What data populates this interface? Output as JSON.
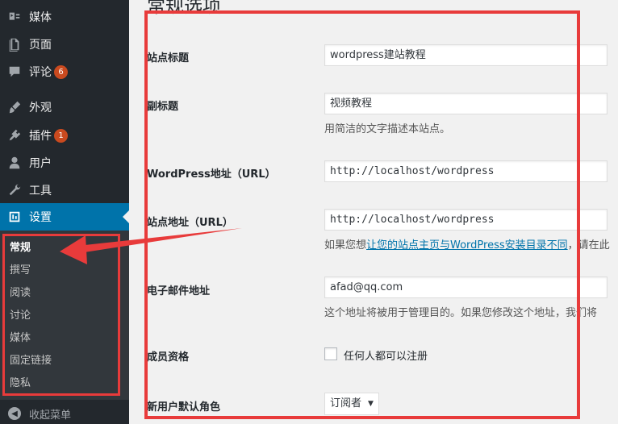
{
  "sidebar": {
    "items": [
      {
        "label": "媒体",
        "icon": "media-icon"
      },
      {
        "label": "页面",
        "icon": "page-icon"
      },
      {
        "label": "评论",
        "icon": "comment-icon",
        "badge": "6"
      },
      {
        "label": "外观",
        "icon": "appearance-icon"
      },
      {
        "label": "插件",
        "icon": "plugin-icon",
        "badge": "1"
      },
      {
        "label": "用户",
        "icon": "user-icon"
      },
      {
        "label": "工具",
        "icon": "tools-icon"
      },
      {
        "label": "设置",
        "icon": "settings-icon"
      }
    ],
    "submenu": [
      "常规",
      "撰写",
      "阅读",
      "讨论",
      "媒体",
      "固定链接",
      "隐私"
    ],
    "collapse_label": "收起菜单"
  },
  "main": {
    "title": "常规选项",
    "fields": {
      "site_title": {
        "label": "站点标题",
        "value": "wordpress建站教程"
      },
      "tagline": {
        "label": "副标题",
        "value": "视频教程",
        "desc": "用简洁的文字描述本站点。"
      },
      "wp_url": {
        "label": "WordPress地址（URL）",
        "value": "http://localhost/wordpress"
      },
      "site_url": {
        "label": "站点地址（URL）",
        "value": "http://localhost/wordpress",
        "desc_prefix": "如果您想",
        "desc_link": "让您的站点主页与WordPress安装目录不同",
        "desc_suffix": "，请在此"
      },
      "email": {
        "label": "电子邮件地址",
        "value": "afad@qq.com",
        "desc": "这个地址将被用于管理目的。如果您修改这个地址，我们将"
      },
      "membership": {
        "label": "成员资格",
        "checkbox_label": "任何人都可以注册"
      },
      "default_role": {
        "label": "新用户默认角色",
        "value": "订阅者"
      }
    }
  },
  "colors": {
    "sidebar_bg": "#23282d",
    "submenu_bg": "#32373c",
    "accent": "#0073aa",
    "badge": "#ca4a1f",
    "highlight_red": "#e83b3b"
  }
}
